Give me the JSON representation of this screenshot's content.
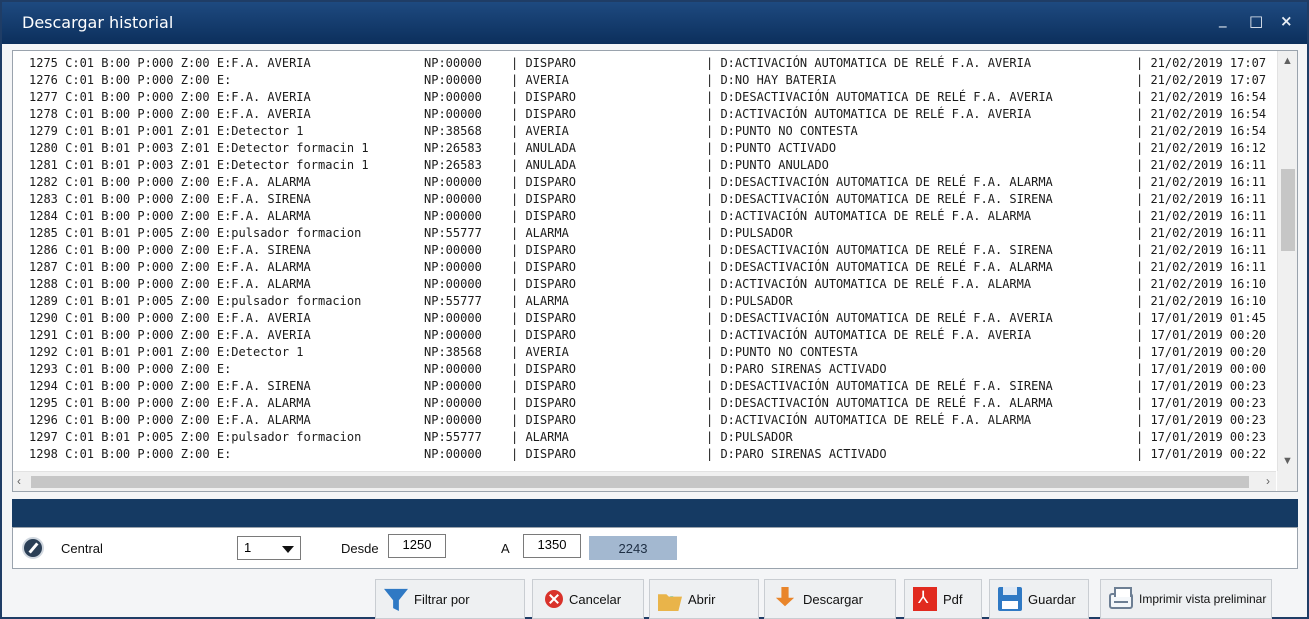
{
  "window": {
    "title": "Descargar historial",
    "controls": {
      "minimize": "_",
      "maximize": "□",
      "close": "×"
    }
  },
  "log": {
    "rows": [
      [
        "1275 C:01 B:00 P:000 Z:00 E:F.A. AVERIA",
        "NP:00000",
        "| DISPARO",
        "| D:ACTIVACIÓN AUTOMATICA DE RELÉ F.A. AVERIA",
        "| 21/02/2019 17:07"
      ],
      [
        "1276 C:01 B:00 P:000 Z:00 E:",
        "NP:00000",
        "| AVERIA",
        "| D:NO HAY BATERIA",
        "| 21/02/2019 17:07"
      ],
      [
        "1277 C:01 B:00 P:000 Z:00 E:F.A. AVERIA",
        "NP:00000",
        "| DISPARO",
        "| D:DESACTIVACIÓN AUTOMATICA DE RELÉ F.A. AVERIA",
        "| 21/02/2019 16:54"
      ],
      [
        "1278 C:01 B:00 P:000 Z:00 E:F.A. AVERIA",
        "NP:00000",
        "| DISPARO",
        "| D:ACTIVACIÓN AUTOMATICA DE RELÉ F.A. AVERIA",
        "| 21/02/2019 16:54"
      ],
      [
        "1279 C:01 B:01 P:001 Z:01 E:Detector 1",
        "NP:38568",
        "| AVERIA",
        "| D:PUNTO NO CONTESTA",
        "| 21/02/2019 16:54"
      ],
      [
        "1280 C:01 B:01 P:003 Z:01 E:Detector formacin 1",
        "NP:26583",
        "| ANULADA",
        "| D:PUNTO ACTIVADO",
        "| 21/02/2019 16:12"
      ],
      [
        "1281 C:01 B:01 P:003 Z:01 E:Detector formacin 1",
        "NP:26583",
        "| ANULADA",
        "| D:PUNTO ANULADO",
        "| 21/02/2019 16:11"
      ],
      [
        "1282 C:01 B:00 P:000 Z:00 E:F.A. ALARMA",
        "NP:00000",
        "| DISPARO",
        "| D:DESACTIVACIÓN AUTOMATICA DE RELÉ F.A. ALARMA",
        "| 21/02/2019 16:11"
      ],
      [
        "1283 C:01 B:00 P:000 Z:00 E:F.A. SIRENA",
        "NP:00000",
        "| DISPARO",
        "| D:DESACTIVACIÓN AUTOMATICA DE RELÉ F.A. SIRENA",
        "| 21/02/2019 16:11"
      ],
      [
        "1284 C:01 B:00 P:000 Z:00 E:F.A. ALARMA",
        "NP:00000",
        "| DISPARO",
        "| D:ACTIVACIÓN AUTOMATICA DE RELÉ F.A. ALARMA",
        "| 21/02/2019 16:11"
      ],
      [
        "1285 C:01 B:01 P:005 Z:00 E:pulsador formacion",
        "NP:55777",
        "| ALARMA",
        "| D:PULSADOR",
        "| 21/02/2019 16:11"
      ],
      [
        "1286 C:01 B:00 P:000 Z:00 E:F.A. SIRENA",
        "NP:00000",
        "| DISPARO",
        "| D:DESACTIVACIÓN AUTOMATICA DE RELÉ F.A. SIRENA",
        "| 21/02/2019 16:11"
      ],
      [
        "1287 C:01 B:00 P:000 Z:00 E:F.A. ALARMA",
        "NP:00000",
        "| DISPARO",
        "| D:DESACTIVACIÓN AUTOMATICA DE RELÉ F.A. ALARMA",
        "| 21/02/2019 16:11"
      ],
      [
        "1288 C:01 B:00 P:000 Z:00 E:F.A. ALARMA",
        "NP:00000",
        "| DISPARO",
        "| D:ACTIVACIÓN AUTOMATICA DE RELÉ F.A. ALARMA",
        "| 21/02/2019 16:10"
      ],
      [
        "1289 C:01 B:01 P:005 Z:00 E:pulsador formacion",
        "NP:55777",
        "| ALARMA",
        "| D:PULSADOR",
        "| 21/02/2019 16:10"
      ],
      [
        "1290 C:01 B:00 P:000 Z:00 E:F.A. AVERIA",
        "NP:00000",
        "| DISPARO",
        "| D:DESACTIVACIÓN AUTOMATICA DE RELÉ F.A. AVERIA",
        "| 17/01/2019 01:45"
      ],
      [
        "1291 C:01 B:00 P:000 Z:00 E:F.A. AVERIA",
        "NP:00000",
        "| DISPARO",
        "| D:ACTIVACIÓN AUTOMATICA DE RELÉ F.A. AVERIA",
        "| 17/01/2019 00:20"
      ],
      [
        "1292 C:01 B:01 P:001 Z:00 E:Detector 1",
        "NP:38568",
        "| AVERIA",
        "| D:PUNTO NO CONTESTA",
        "| 17/01/2019 00:20"
      ],
      [
        "1293 C:01 B:00 P:000 Z:00 E:",
        "NP:00000",
        "| DISPARO",
        "| D:PARO SIRENAS ACTIVADO",
        "| 17/01/2019 00:00"
      ],
      [
        "1294 C:01 B:00 P:000 Z:00 E:F.A. SIRENA",
        "NP:00000",
        "| DISPARO",
        "| D:DESACTIVACIÓN AUTOMATICA DE RELÉ F.A. SIRENA",
        "| 17/01/2019 00:23"
      ],
      [
        "1295 C:01 B:00 P:000 Z:00 E:F.A. ALARMA",
        "NP:00000",
        "| DISPARO",
        "| D:DESACTIVACIÓN AUTOMATICA DE RELÉ F.A. ALARMA",
        "| 17/01/2019 00:23"
      ],
      [
        "1296 C:01 B:00 P:000 Z:00 E:F.A. ALARMA",
        "NP:00000",
        "| DISPARO",
        "| D:ACTIVACIÓN AUTOMATICA DE RELÉ F.A. ALARMA",
        "| 17/01/2019 00:23"
      ],
      [
        "1297 C:01 B:01 P:005 Z:00 E:pulsador formacion",
        "NP:55777",
        "| ALARMA",
        "| D:PULSADOR",
        "| 17/01/2019 00:23"
      ],
      [
        "1298 C:01 B:00 P:000 Z:00 E:",
        "NP:00000",
        "| DISPARO",
        "| D:PARO SIRENAS ACTIVADO",
        "| 17/01/2019 00:22"
      ]
    ]
  },
  "filters": {
    "central_label": "Central",
    "central_value": "1",
    "desde_label": "Desde",
    "desde_value": "1250",
    "a_label": "A",
    "a_value": "1350",
    "total_count": "2243"
  },
  "toolbar": {
    "filter_label": "Filtrar por",
    "cancel_label": "Cancelar",
    "open_label": "Abrir",
    "download_label": "Descargar",
    "pdf_label": "Pdf",
    "save_label": "Guardar",
    "print_label": "Imprimir vista preliminar"
  },
  "colors": {
    "titlebar": "#0c2f5c",
    "bluebar": "#153a63",
    "count_bg": "#a3b8d0"
  }
}
